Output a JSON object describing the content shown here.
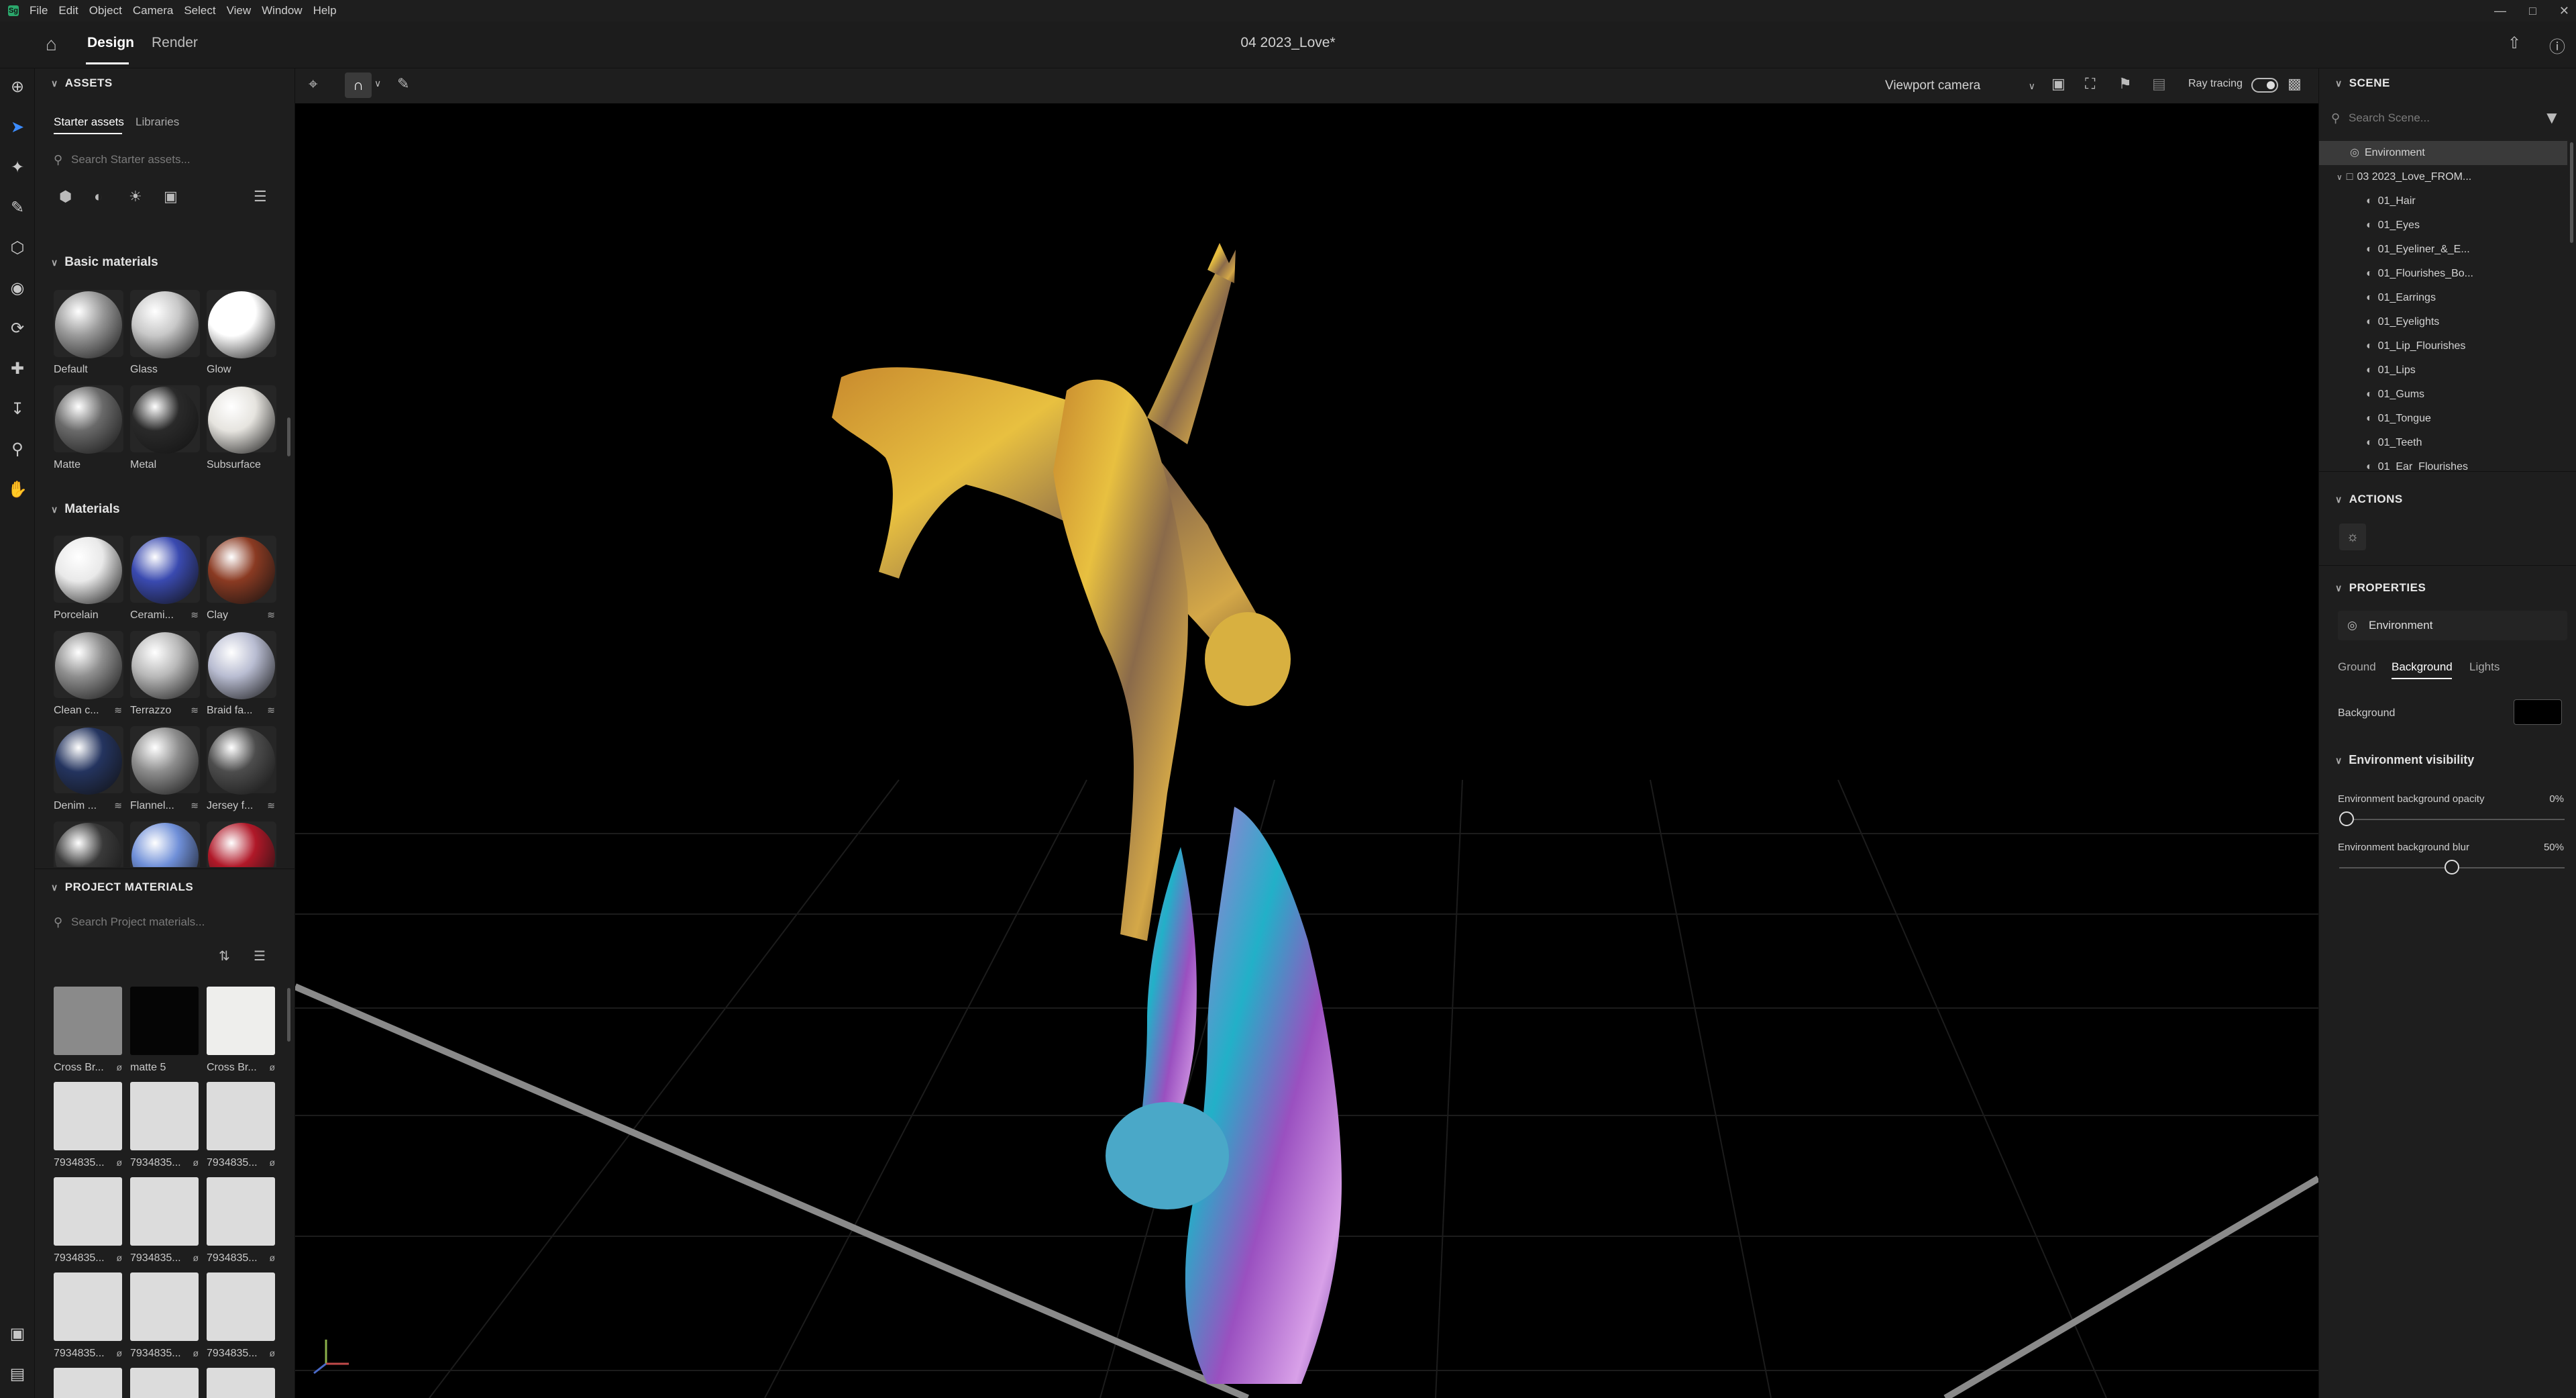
{
  "menu": [
    "File",
    "Edit",
    "Object",
    "Camera",
    "Select",
    "View",
    "Window",
    "Help"
  ],
  "header": {
    "tabs": [
      "Design",
      "Render"
    ],
    "document_title": "04 2023_Love*"
  },
  "viewport_toolbar": {
    "camera": "Viewport camera",
    "ray_tracing_label": "Ray tracing"
  },
  "assets": {
    "title": "ASSETS",
    "tabs": [
      "Starter assets",
      "Libraries"
    ],
    "search_placeholder": "Search Starter assets...",
    "basic_title": "Basic materials",
    "basic": [
      {
        "label": "Default",
        "color": "#9a9a9a"
      },
      {
        "label": "Glass",
        "color": "#c8c8c8"
      },
      {
        "label": "Glow",
        "color": "#ffffff"
      },
      {
        "label": "Matte",
        "color": "#6a6a6a"
      },
      {
        "label": "Metal",
        "color": "#2a2a2a"
      },
      {
        "label": "Subsurface",
        "color": "#e6e4df"
      }
    ],
    "materials_title": "Materials",
    "materials": [
      {
        "label": "Porcelain",
        "color": "#e9e9e9",
        "badge": ""
      },
      {
        "label": "Cerami...",
        "color": "#3a4ab0",
        "badge": "≋"
      },
      {
        "label": "Clay",
        "color": "#8a3a22",
        "badge": "≋"
      },
      {
        "label": "Clean c...",
        "color": "#8f8f8f",
        "badge": "≋"
      },
      {
        "label": "Terrazzo",
        "color": "#b9b9b9",
        "badge": "≋"
      },
      {
        "label": "Braid fa...",
        "color": "#b9bdd2",
        "badge": "≋"
      },
      {
        "label": "Denim ...",
        "color": "#24345f",
        "badge": "≋"
      },
      {
        "label": "Flannel...",
        "color": "#8d8d8d",
        "badge": "≋"
      },
      {
        "label": "Jersey f...",
        "color": "#4d4d4d",
        "badge": "≋"
      },
      {
        "label": "",
        "color": "#3a3a3a",
        "badge": ""
      },
      {
        "label": "",
        "color": "#6f8fd8",
        "badge": ""
      },
      {
        "label": "",
        "color": "#b01828",
        "badge": ""
      }
    ]
  },
  "project_materials": {
    "title": "PROJECT MATERIALS",
    "search_placeholder": "Search Project materials...",
    "items": [
      {
        "label": "Cross Br...",
        "color": "#8a8a8a"
      },
      {
        "label": "matte 5",
        "color": "#050505"
      },
      {
        "label": "Cross Br...",
        "color": "#eeeeec"
      },
      {
        "label": "7934835...",
        "color": "#dcdcdc"
      },
      {
        "label": "7934835...",
        "color": "#dcdcdc"
      },
      {
        "label": "7934835...",
        "color": "#dcdcdc"
      },
      {
        "label": "7934835...",
        "color": "#dcdcdc"
      },
      {
        "label": "7934835...",
        "color": "#dcdcdc"
      },
      {
        "label": "7934835...",
        "color": "#dcdcdc"
      },
      {
        "label": "7934835...",
        "color": "#dcdcdc"
      },
      {
        "label": "7934835...",
        "color": "#dcdcdc"
      },
      {
        "label": "7934835...",
        "color": "#dcdcdc"
      }
    ]
  },
  "scene": {
    "title": "SCENE",
    "search_placeholder": "Search Scene...",
    "items": [
      "Environment",
      "03 2023_Love_FROM...",
      "01_Hair",
      "01_Eyes",
      "01_Eyeliner_&_E...",
      "01_Flourishes_Bo...",
      "01_Earrings",
      "01_Eyelights",
      "01_Lip_Flourishes",
      "01_Lips",
      "01_Gums",
      "01_Tongue",
      "01_Teeth",
      "01_Ear_Flourishes"
    ]
  },
  "actions": {
    "title": "ACTIONS"
  },
  "properties": {
    "title": "PROPERTIES",
    "object": "Environment",
    "tabs": [
      "Ground",
      "Background",
      "Lights"
    ],
    "background_label": "Background",
    "background_color": "#000000",
    "env_vis_title": "Environment visibility",
    "opacity_label": "Environment background opacity",
    "opacity_value": "0%",
    "opacity_fraction": 0.0,
    "blur_label": "Environment background blur",
    "blur_value": "50%",
    "blur_fraction": 0.5
  },
  "colors": {
    "accent": "#3c8cff",
    "selected_row": "#3a3a3a"
  }
}
